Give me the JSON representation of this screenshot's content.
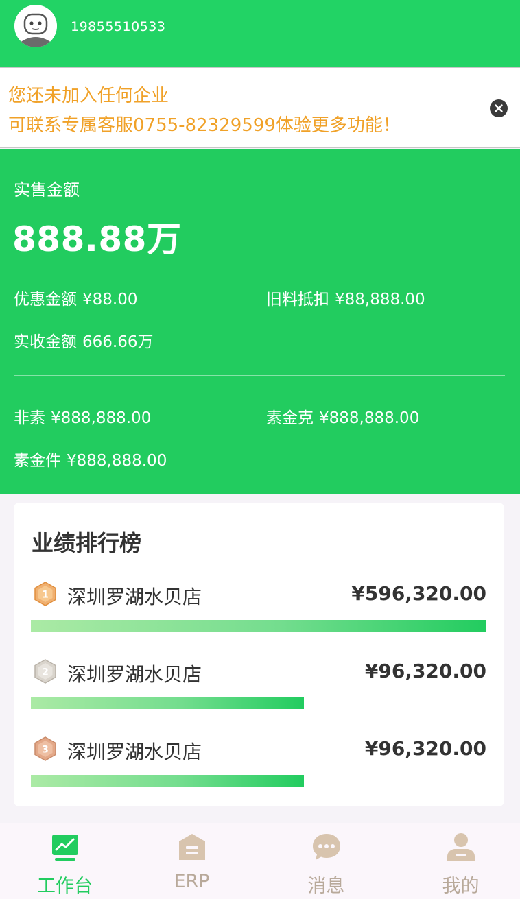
{
  "header": {
    "phone": "19855510533",
    "avatar_icon": "avatar-face-icon"
  },
  "notice": {
    "line1": "您还未加入任何企业",
    "line2": "可联系专属客服0755-82329599体验更多功能！",
    "close_icon": "close-icon"
  },
  "stats": {
    "main_label": "实售金额",
    "main_value": "888.88万",
    "discount_label": "优惠金额",
    "discount_value": "¥88.00",
    "old_material_label": "旧料抵扣",
    "old_material_value": "¥88,888.00",
    "received_label": "实收金额",
    "received_value": "666.66万",
    "non_plain_label": "非素",
    "non_plain_value": "¥888,888.00",
    "plain_gold_gram_label": "素金克",
    "plain_gold_gram_value": "¥888,888.00",
    "plain_gold_piece_label": "素金件",
    "plain_gold_piece_value": "¥888,888.00"
  },
  "ranking": {
    "title": "业绩排行榜",
    "items": [
      {
        "rank": "1",
        "name": "深圳罗湖水贝店",
        "amount": "¥596,320.00",
        "progress": 1.0
      },
      {
        "rank": "2",
        "name": "深圳罗湖水贝店",
        "amount": "¥96,320.00",
        "progress": 0.6
      },
      {
        "rank": "3",
        "name": "深圳罗湖水贝店",
        "amount": "¥96,320.00",
        "progress": 0.6
      }
    ]
  },
  "nav": {
    "items": [
      {
        "label": "工作台",
        "icon": "chart-icon",
        "active": true
      },
      {
        "label": "ERP",
        "icon": "warehouse-icon",
        "active": false
      },
      {
        "label": "消息",
        "icon": "chat-icon",
        "active": false
      },
      {
        "label": "我的",
        "icon": "user-icon",
        "active": false
      }
    ]
  },
  "colors": {
    "primary": "#22cc5f",
    "header_bg": "#22d365",
    "notice_text": "#f0a128",
    "nav_inactive": "#b8a99a"
  }
}
